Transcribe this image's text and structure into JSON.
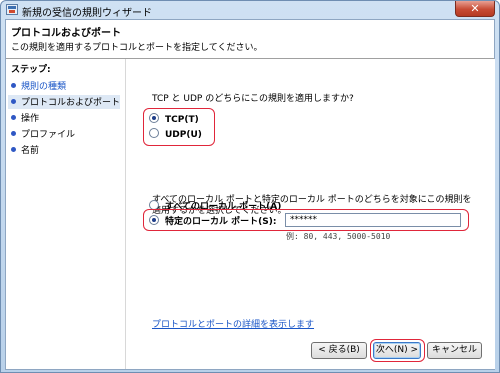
{
  "window": {
    "title": "新規の受信の規則ウィザード",
    "close_label": "✕"
  },
  "header": {
    "title": "プロトコルおよびポート",
    "description": "この規則を適用するプロトコルとポートを指定してください。"
  },
  "sidebar": {
    "steps_label": "ステップ:",
    "items": [
      {
        "label": "規則の種類",
        "state": "link"
      },
      {
        "label": "プロトコルおよびポート",
        "state": "current"
      },
      {
        "label": "操作",
        "state": "pending"
      },
      {
        "label": "プロファイル",
        "state": "pending"
      },
      {
        "label": "名前",
        "state": "pending"
      }
    ]
  },
  "protocol": {
    "question": "TCP と UDP のどちらにこの規則を適用しますか?",
    "options": [
      {
        "label": "TCP(T)",
        "selected": true
      },
      {
        "label": "UDP(U)",
        "selected": false
      }
    ]
  },
  "ports": {
    "question": "すべてのローカル ポートと特定のローカル ポートのどちらを対象にこの規則を適用するかを選択してください。",
    "options": [
      {
        "label": "すべてのローカル ポート(A)",
        "selected": false
      },
      {
        "label": "特定のローカル ポート(S):",
        "selected": true
      }
    ],
    "input_value": "******",
    "example": "例: 80, 443, 5000-5010"
  },
  "more_link": "プロトコルとポートの詳細を表示します",
  "buttons": {
    "back": "< 戻る(B)",
    "next": "次へ(N) >",
    "cancel": "キャンセル"
  },
  "colors": {
    "highlight": "#e0263a",
    "link": "#1a56c7",
    "step_dot": "#2f58c4"
  }
}
